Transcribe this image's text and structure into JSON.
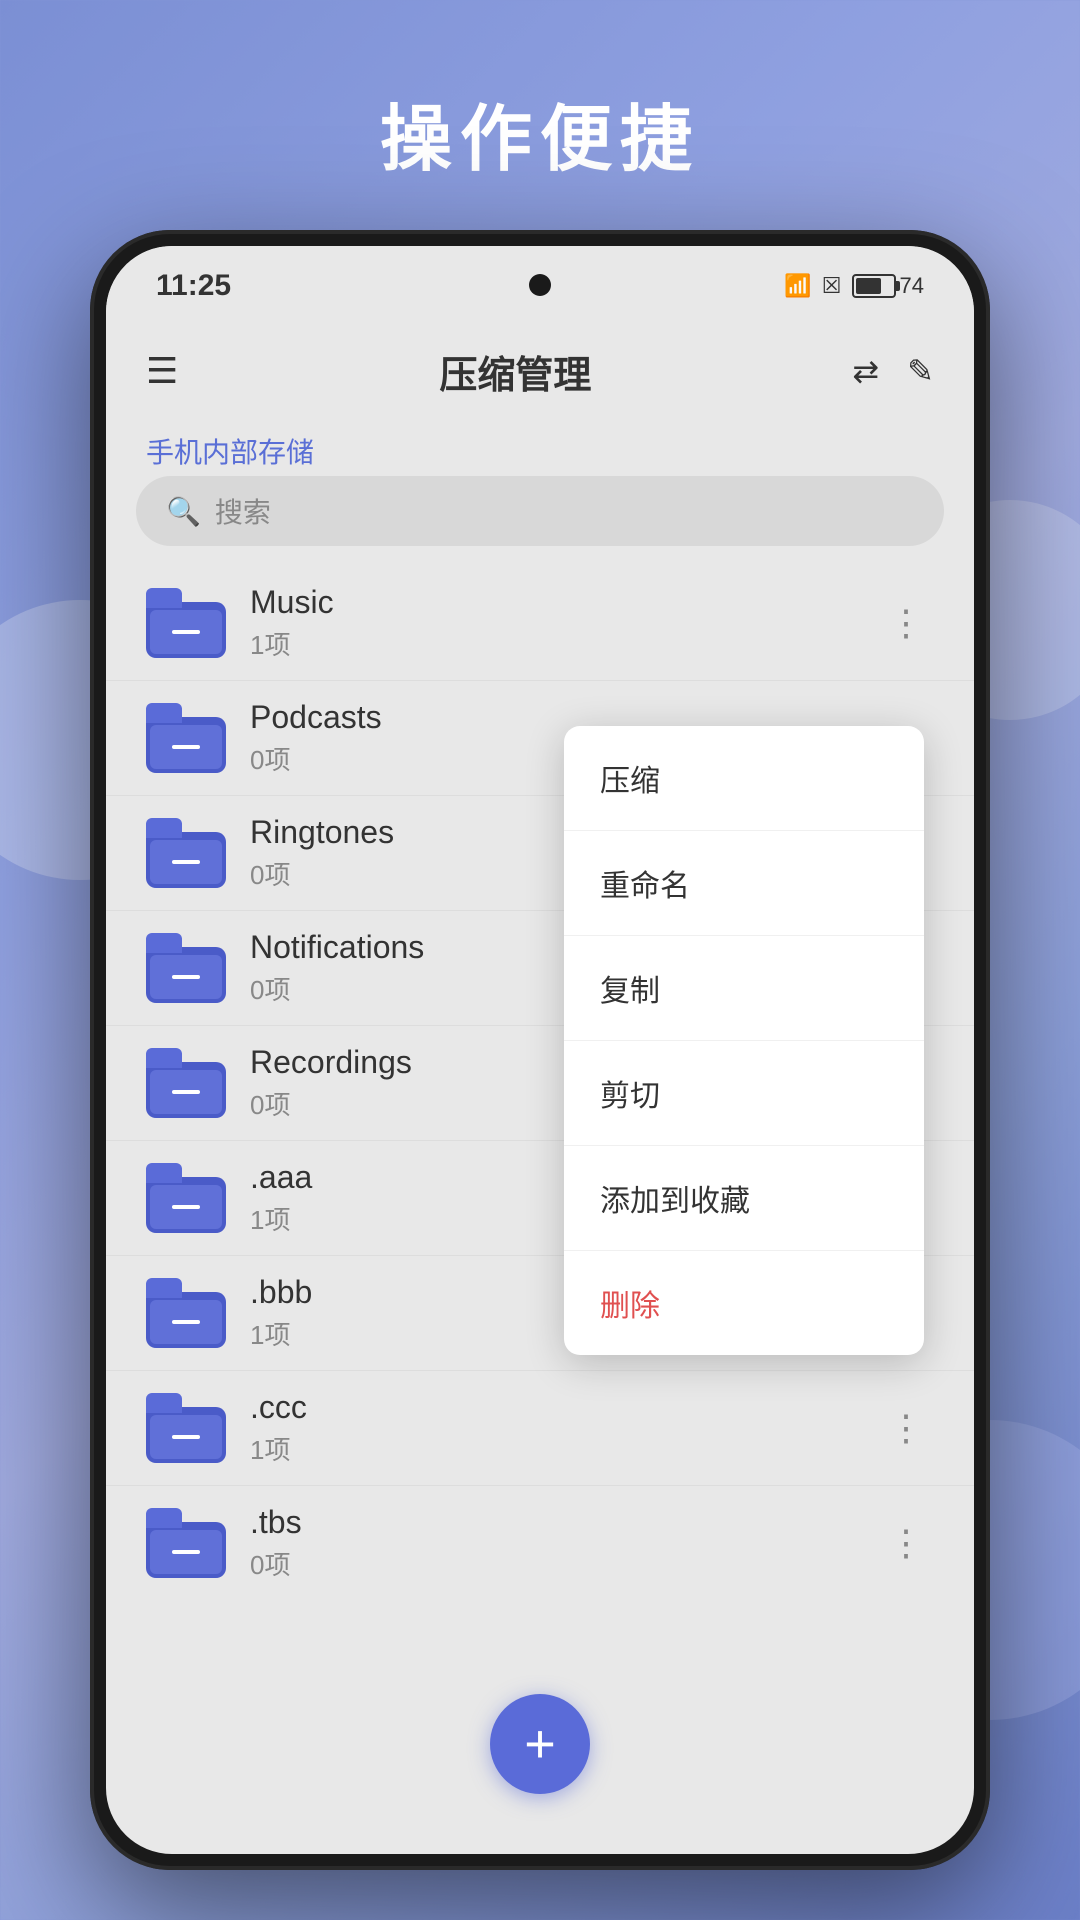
{
  "page": {
    "title": "操作便捷",
    "background_colors": [
      "#7b8fd4",
      "#6b7fc8"
    ]
  },
  "status_bar": {
    "time": "11:25",
    "battery_level": "74"
  },
  "header": {
    "title": "压缩管理",
    "menu_icon": "☰",
    "sort_icon": "⇅",
    "edit_icon": "✎"
  },
  "storage_label": "手机内部存储",
  "search": {
    "placeholder": "搜索"
  },
  "files": [
    {
      "name": "Music",
      "count": "1项"
    },
    {
      "name": "Podcasts",
      "count": "0项"
    },
    {
      "name": "Ringtones",
      "count": "0项"
    },
    {
      "name": "Notifications",
      "count": "0项"
    },
    {
      "name": "Recordings",
      "count": "0项"
    },
    {
      "name": ".aaa",
      "count": "1项"
    },
    {
      "name": ".bbb",
      "count": "1项"
    },
    {
      "name": ".ccc",
      "count": "1项"
    },
    {
      "name": ".tbs",
      "count": "0项"
    }
  ],
  "context_menu": {
    "items": [
      {
        "label": "压缩",
        "danger": false
      },
      {
        "label": "重命名",
        "danger": false
      },
      {
        "label": "复制",
        "danger": false
      },
      {
        "label": "剪切",
        "danger": false
      },
      {
        "label": "添加到收藏",
        "danger": false
      },
      {
        "label": "删除",
        "danger": true
      }
    ]
  },
  "fab": {
    "label": "+"
  }
}
